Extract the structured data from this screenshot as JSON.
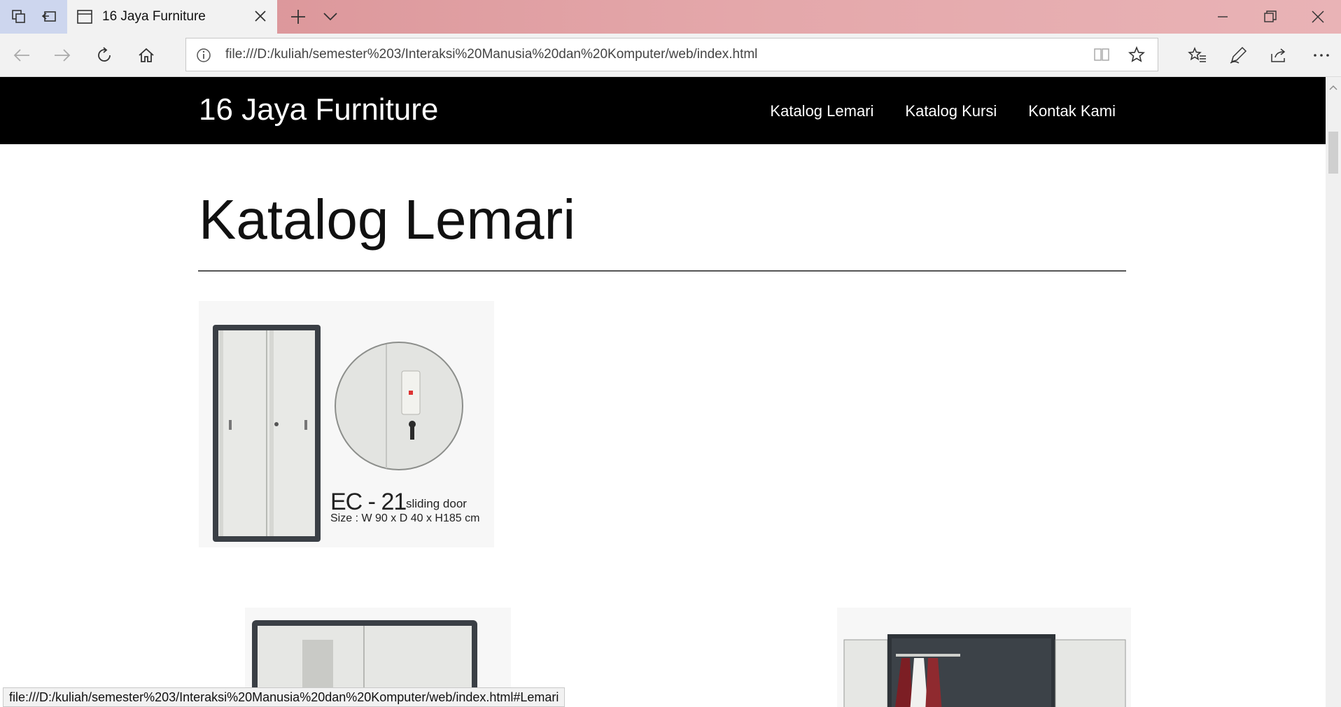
{
  "browser": {
    "tab_title": "16 Jaya Furniture",
    "url": "file:///D:/kuliah/semester%203/Interaksi%20Manusia%20dan%20Komputer/web/index.html",
    "status_url": "file:///D:/kuliah/semester%203/Interaksi%20Manusia%20dan%20Komputer/web/index.html#Lemari"
  },
  "site": {
    "brand": "16 Jaya Furniture",
    "nav": [
      "Katalog Lemari",
      "Katalog Kursi",
      "Kontak Kami"
    ]
  },
  "main": {
    "section_title": "Katalog Lemari",
    "products": [
      {
        "model": "EC - 21",
        "type": "sliding door",
        "size": "Size : W 90 x D 40 x H185 cm"
      }
    ]
  }
}
